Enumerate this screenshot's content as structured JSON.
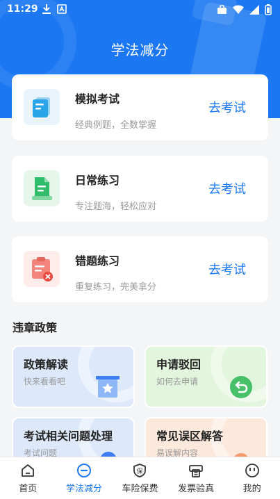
{
  "status_bar": {
    "time": "11:29"
  },
  "header": {
    "title": "学法减分"
  },
  "cards": [
    {
      "title": "模拟考试",
      "subtitle": "经典例题，全数掌握",
      "button": "去考试",
      "icon": "exam-paper-icon"
    },
    {
      "title": "日常练习",
      "subtitle": "专注题海，轻松应对",
      "button": "去考试",
      "icon": "practice-doc-icon"
    },
    {
      "title": "错题练习",
      "subtitle": "重复练习，完美拿分",
      "button": "去考试",
      "icon": "wrong-questions-icon"
    }
  ],
  "section": {
    "title": "违章政策"
  },
  "tiles": [
    {
      "title": "政策解读",
      "subtitle": "快来看看吧",
      "icon": "policy-board-icon",
      "color": "#dde9fb"
    },
    {
      "title": "申请驳回",
      "subtitle": "如何去申请",
      "icon": "return-arrow-icon",
      "color": "#e2f5dd"
    },
    {
      "title": "考试相关问题处理",
      "subtitle": "考试问题",
      "icon": "exam-issue-icon",
      "color": "#dde9fb"
    },
    {
      "title": "常见误区解答",
      "subtitle": "易误解内容",
      "icon": "misconception-icon",
      "color": "#fde8dc"
    }
  ],
  "nav": [
    {
      "label": "首页",
      "icon": "home-icon"
    },
    {
      "label": "学法减分",
      "icon": "minus-circle-icon",
      "active": true
    },
    {
      "label": "车险保费",
      "icon": "shield-icon"
    },
    {
      "label": "发票验真",
      "icon": "invoice-printer-icon"
    },
    {
      "label": "我的",
      "icon": "smiley-icon"
    }
  ],
  "colors": {
    "primary": "#1b78f2",
    "background": "#f4f5f7"
  }
}
